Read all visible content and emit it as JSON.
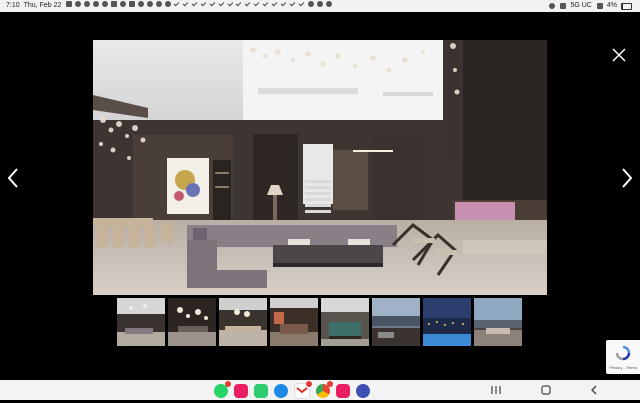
{
  "status_bar": {
    "time": "7:10",
    "date": "Thu, Feb 22",
    "network": "5G UC",
    "battery": "4%"
  },
  "viewer": {
    "main_photo": "living-room-photo",
    "thumbnails": [
      {
        "name": "living-room"
      },
      {
        "name": "chandelier-hall"
      },
      {
        "name": "dining-room"
      },
      {
        "name": "game-room"
      },
      {
        "name": "pool-table-room"
      },
      {
        "name": "view-terrace"
      },
      {
        "name": "city-view-pool"
      },
      {
        "name": "lounge-view"
      }
    ]
  },
  "recaptcha": {
    "text": "Privacy - Terms"
  },
  "taskbar": {
    "apps": [
      {
        "name": "whatsapp",
        "color": "#25d366",
        "badge": true
      },
      {
        "name": "messages",
        "color": "#e91e63",
        "badge": false
      },
      {
        "name": "contacts",
        "color": "#2ecc71",
        "badge": false
      },
      {
        "name": "chat",
        "color": "#1e88e5",
        "badge": false
      },
      {
        "name": "gmail",
        "color": "#ffffff",
        "badge": true
      },
      {
        "name": "chrome",
        "color": "#fbc02d",
        "badge": true
      },
      {
        "name": "flower-app",
        "color": "#e91e63",
        "badge": false
      },
      {
        "name": "settings",
        "color": "#3f51b5",
        "badge": false
      }
    ]
  }
}
